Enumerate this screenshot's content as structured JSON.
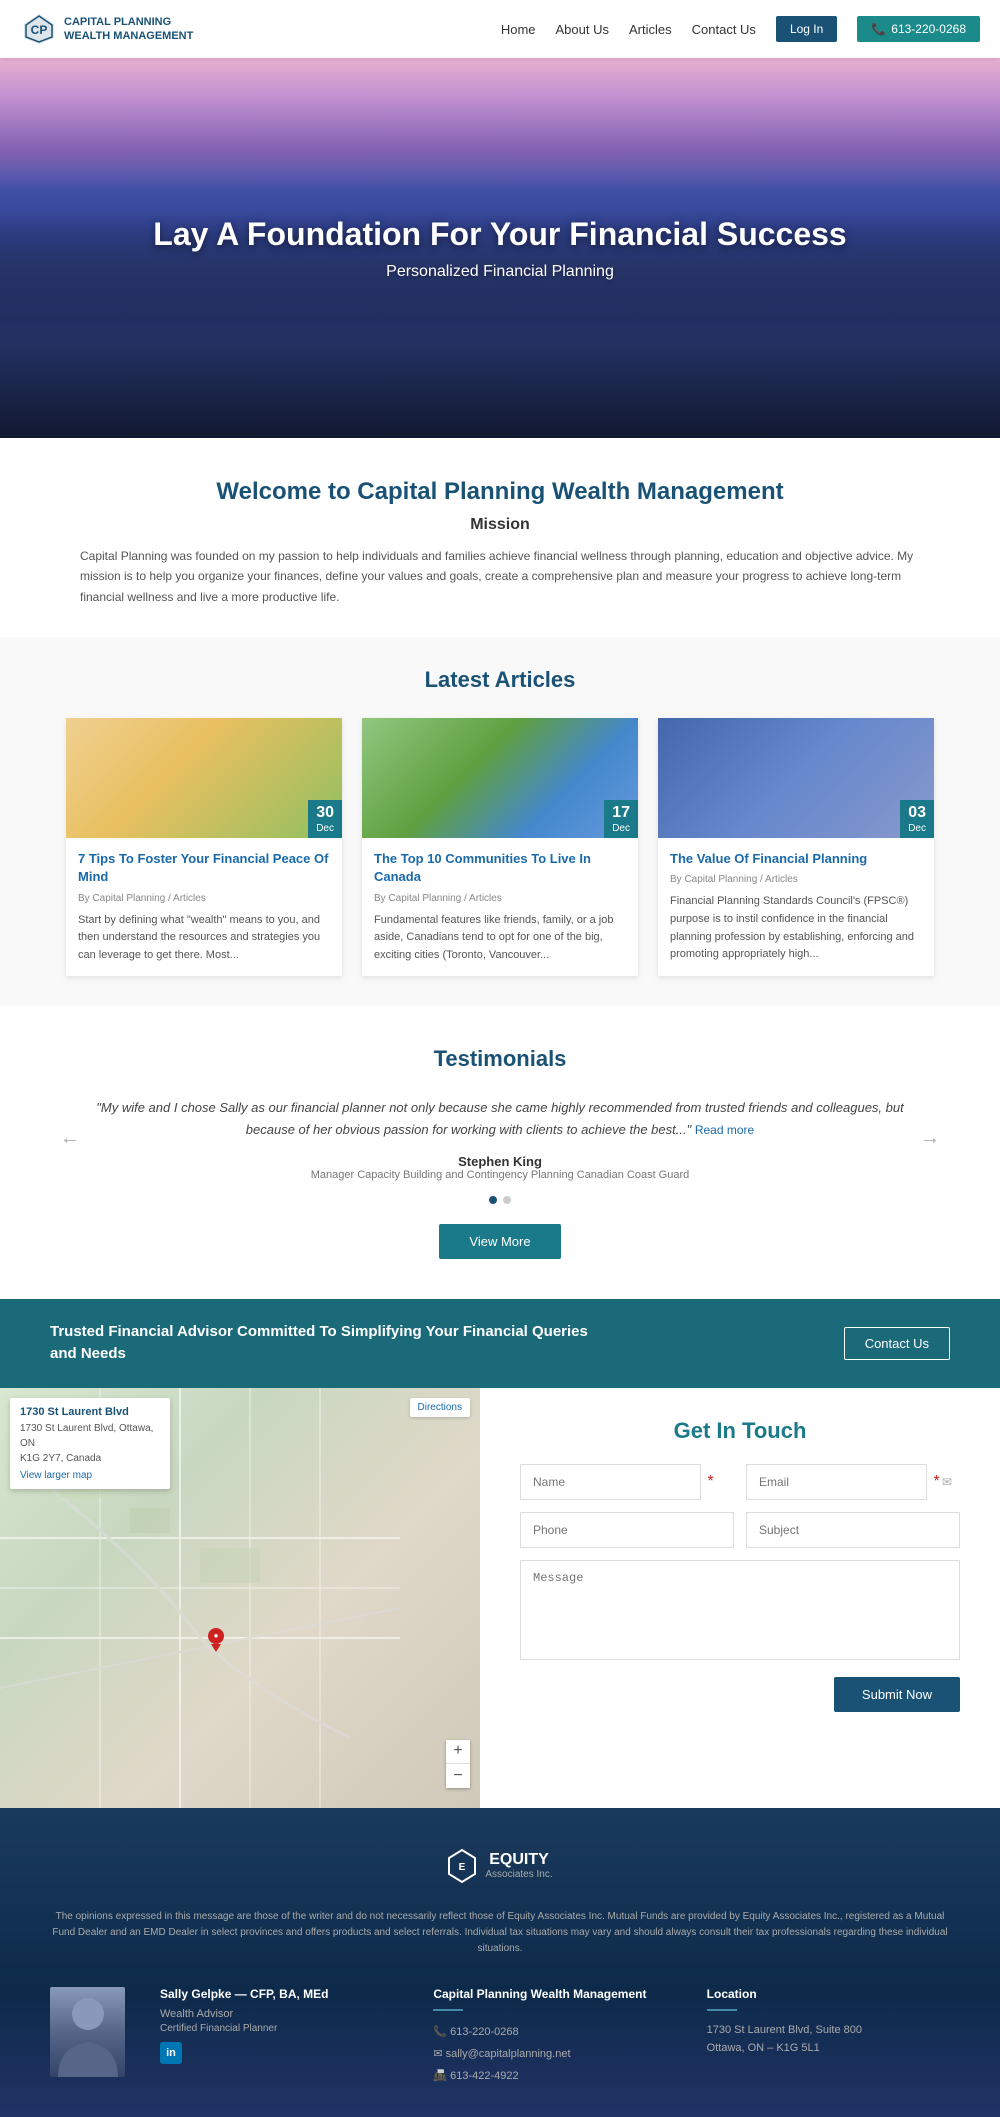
{
  "nav": {
    "logo_line1": "CAPITAL PLANNING",
    "logo_line2": "WEALTH MANAGEMENT",
    "links": [
      "Home",
      "About Us",
      "Articles",
      "Contact Us"
    ],
    "login_label": "Log In",
    "phone_label": "613-220-0268"
  },
  "hero": {
    "title": "Lay A Foundation For Your Financial Success",
    "subtitle": "Personalized Financial Planning"
  },
  "welcome": {
    "title": "Welcome to Capital Planning Wealth Management",
    "mission_heading": "Mission",
    "mission_text": "Capital Planning was founded on my passion to help individuals and families achieve financial wellness through planning, education and objective advice. My mission is to help you organize your finances, define your values and goals, create a comprehensive plan and measure your progress to achieve long-term financial wellness and live a more productive life."
  },
  "articles": {
    "section_title": "Latest Articles",
    "items": [
      {
        "date_day": "30",
        "date_month": "Dec",
        "title": "7 Tips To Foster Your Financial Peace Of Mind",
        "by": "By Capital Planning / Articles",
        "excerpt": "Start by defining what \"wealth\" means to you, and then understand the resources and strategies you can leverage to get there. Most..."
      },
      {
        "date_day": "17",
        "date_month": "Dec",
        "title": "The Top 10 Communities To Live In Canada",
        "by": "By Capital Planning / Articles",
        "excerpt": "Fundamental features like friends, family, or a job aside, Canadians tend to opt for one of the big, exciting cities (Toronto, Vancouver..."
      },
      {
        "date_day": "03",
        "date_month": "Dec",
        "title": "The Value Of Financial Planning",
        "by": "By Capital Planning / Articles",
        "excerpt": "Financial Planning Standards Council's (FPSC®) purpose is to instil confidence in the financial planning profession by establishing, enforcing and promoting appropriately high..."
      }
    ]
  },
  "testimonials": {
    "section_title": "Testimonials",
    "quote": "\"My wife and I chose Sally as our financial planner not only because she came highly recommended from trusted friends and colleagues, but because of her obvious passion for working with clients to achieve the best...\"",
    "read_more": "Read more",
    "author": "Stephen King",
    "author_role": "Manager Capacity Building and Contingency Planning Canadian Coast Guard",
    "view_more_label": "View More"
  },
  "cta": {
    "text": "Trusted Financial Advisor Committed To Simplifying Your Financial Queries and Needs",
    "button_label": "Contact Us"
  },
  "map": {
    "address_title": "1730 St Laurent Blvd",
    "address_detail": "1730 St Laurent Blvd, Ottawa, ON\nK1G 2Y7, Canada",
    "larger_map_label": "View larger map",
    "directions_label": "Directions"
  },
  "contact_form": {
    "section_title": "Get In Touch",
    "name_placeholder": "Name",
    "email_placeholder": "Email",
    "phone_placeholder": "Phone",
    "subject_placeholder": "Subject",
    "message_placeholder": "Message",
    "submit_label": "Submit Now"
  },
  "footer": {
    "equity_logo_text": "EQUITY",
    "equity_logo_sub": "Associates Inc.",
    "disclaimer": "The opinions expressed in this message are those of the writer and do not necessarily reflect those of Equity Associates Inc. Mutual Funds are provided by Equity Associates Inc., registered as a Mutual Fund Dealer and an EMD Dealer in select provinces and offers products and select referrals. Individual tax situations may vary and should always consult their tax professionals regarding these individual situations.",
    "advisor_name": "Sally Gelpke — CFP, BA, MEd",
    "advisor_title": "Wealth Advisor",
    "advisor_credential": "Certified Financial Planner",
    "company_col_title": "Capital Planning Wealth Management",
    "company_phone": "613-220-0268",
    "company_email": "sally@capitalplanning.net",
    "company_fax": "613-422-4922",
    "location_col_title": "Location",
    "location_address": "1730 St Laurent Blvd, Suite 800\nOttawa, ON – K1G 5L1"
  }
}
